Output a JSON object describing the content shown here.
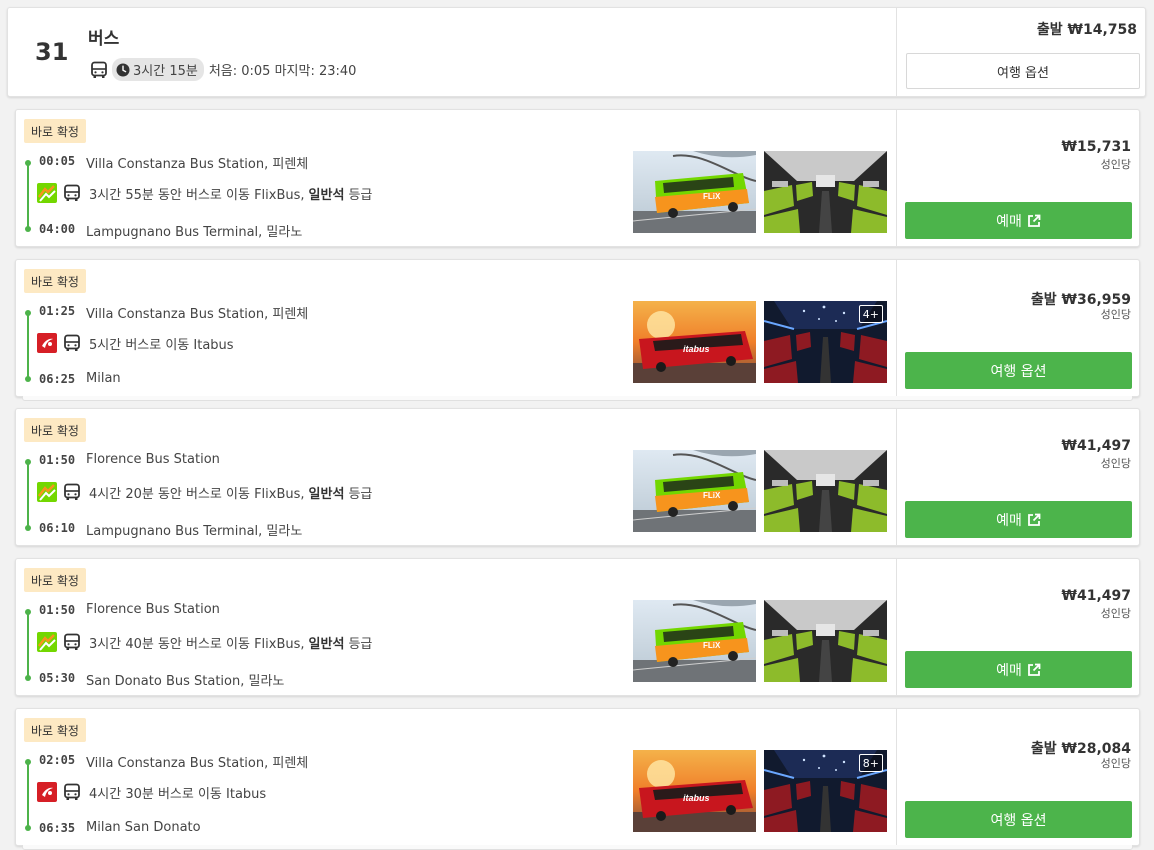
{
  "colors": {
    "accent_green": "#4cb44b",
    "badge_bg": "#fde9c3",
    "flixbus_green": "#73d700",
    "itabus_red": "#d61f26"
  },
  "header": {
    "route_number": "31",
    "mode_title": "버스",
    "duration": "3시간 15분",
    "schedule": "처음: 0:05 마지막: 23:40",
    "price": "출발 ₩14,758",
    "options_label": "여행 옵션"
  },
  "results": [
    {
      "badge": "바로 확정",
      "depart_time": "00:05",
      "depart_station": "Villa Constanza Bus Station, 피렌체",
      "operator": "flixbus",
      "operator_icon": "flixbus-logo-icon",
      "trip_text": "3시간 55분 동안 버스로 이동 FlixBus,",
      "class_bold": "일반석",
      "class_suffix": "등급",
      "arrive_time": "04:00",
      "arrive_station": "Lampugnano Bus Terminal, 밀라노",
      "more_photos": "",
      "price": "₩15,731",
      "per": "성인당",
      "action": "예매",
      "action_external": true
    },
    {
      "badge": "바로 확정",
      "depart_time": "01:25",
      "depart_station": "Villa Constanza Bus Station, 피렌체",
      "operator": "itabus",
      "operator_icon": "itabus-logo-icon",
      "trip_text": "5시간 버스로 이동 Itabus",
      "class_bold": "",
      "class_suffix": "",
      "arrive_time": "06:25",
      "arrive_station": "Milan",
      "more_photos": "4+",
      "price": "출발 ₩36,959",
      "per": "성인당",
      "action": "여행 옵션",
      "action_external": false
    },
    {
      "badge": "바로 확정",
      "depart_time": "01:50",
      "depart_station": "Florence Bus Station",
      "operator": "flixbus",
      "operator_icon": "flixbus-logo-icon",
      "trip_text": "4시간 20분 동안 버스로 이동 FlixBus,",
      "class_bold": "일반석",
      "class_suffix": "등급",
      "arrive_time": "06:10",
      "arrive_station": "Lampugnano Bus Terminal, 밀라노",
      "more_photos": "",
      "price": "₩41,497",
      "per": "성인당",
      "action": "예매",
      "action_external": true
    },
    {
      "badge": "바로 확정",
      "depart_time": "01:50",
      "depart_station": "Florence Bus Station",
      "operator": "flixbus",
      "operator_icon": "flixbus-logo-icon",
      "trip_text": "3시간 40분 동안 버스로 이동 FlixBus,",
      "class_bold": "일반석",
      "class_suffix": "등급",
      "arrive_time": "05:30",
      "arrive_station": "San Donato Bus Station, 밀라노",
      "more_photos": "",
      "price": "₩41,497",
      "per": "성인당",
      "action": "예매",
      "action_external": true
    },
    {
      "badge": "바로 확정",
      "depart_time": "02:05",
      "depart_station": "Villa Constanza Bus Station, 피렌체",
      "operator": "itabus",
      "operator_icon": "itabus-logo-icon",
      "trip_text": "4시간 30분 버스로 이동 Itabus",
      "class_bold": "",
      "class_suffix": "",
      "arrive_time": "06:35",
      "arrive_station": "Milan San Donato",
      "more_photos": "8+",
      "price": "출발 ₩28,084",
      "per": "성인당",
      "action": "여행 옵션",
      "action_external": false
    }
  ]
}
